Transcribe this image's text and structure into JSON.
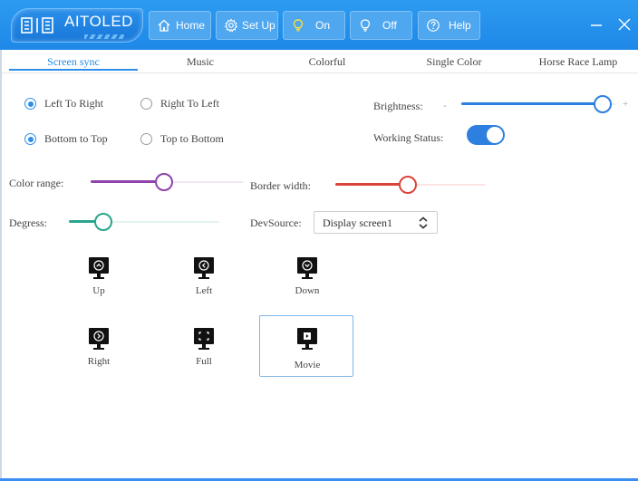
{
  "app": {
    "title": "AITOLED",
    "colors": {
      "titlebar": "#2d9bf0",
      "accent": "#2d8fea",
      "purple": "#8e44ad",
      "red": "#d9453a",
      "teal": "#2aa48c"
    }
  },
  "toolbar": {
    "home_label": "Home",
    "setup_label": "Set Up",
    "on_label": "On",
    "off_label": "Off",
    "help_label": "Help"
  },
  "tabs": [
    {
      "label": "Screen sync",
      "active": true
    },
    {
      "label": "Music"
    },
    {
      "label": "Colorful"
    },
    {
      "label": "Single Color"
    },
    {
      "label": "Horse Race Lamp"
    }
  ],
  "direction": {
    "left_to_right": "Left To Right",
    "right_to_left": "Right To Left",
    "bottom_to_top": "Bottom to Top",
    "top_to_bottom": "Top to Bottom",
    "selected_horizontal": "Left To Right",
    "selected_vertical": "Bottom to Top"
  },
  "brightness": {
    "label": "Brightness:",
    "minus": "-",
    "plus": "+",
    "value": 0.92
  },
  "working_status": {
    "label": "Working Status:",
    "on": true
  },
  "color_range": {
    "label": "Color range:",
    "value": 0.48
  },
  "border_width": {
    "label": "Border width:",
    "value": 0.48
  },
  "degress": {
    "label": "Degress:",
    "value": 0.23
  },
  "dev_source": {
    "label": "DevSource:",
    "value": "Display screen1"
  },
  "modes": [
    {
      "label": "Up",
      "icon": "monitor-up-icon"
    },
    {
      "label": "Left",
      "icon": "monitor-left-icon"
    },
    {
      "label": "Down",
      "icon": "monitor-down-icon"
    },
    {
      "label": "Right",
      "icon": "monitor-right-icon"
    },
    {
      "label": "Full",
      "icon": "monitor-full-icon"
    },
    {
      "label": "Movie",
      "icon": "monitor-movie-icon",
      "selected": true
    }
  ]
}
